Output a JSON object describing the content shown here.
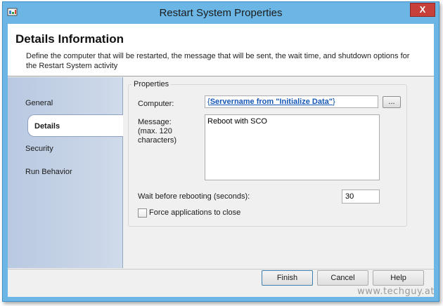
{
  "window": {
    "title": "Restart System Properties",
    "close_glyph": "X",
    "app_icon": "app-icon"
  },
  "header": {
    "title": "Details Information",
    "description": "Define the computer that will be restarted, the message that will be sent, the wait time, and shutdown options for the Restart System activity"
  },
  "sidebar": {
    "items": [
      {
        "label": "General",
        "selected": false
      },
      {
        "label": "Details",
        "selected": true
      },
      {
        "label": "Security",
        "selected": false
      },
      {
        "label": "Run Behavior",
        "selected": false
      }
    ]
  },
  "properties": {
    "group_label": "Properties",
    "computer_label": "Computer:",
    "computer_value_open": "{",
    "computer_value_link": "Servername from \"Initialize Data\"",
    "computer_value_close": "}",
    "browse_label": "...",
    "message_label": "Message:",
    "message_hint_1": "(max. 120",
    "message_hint_2": "characters)",
    "message_value": "Reboot with SCO",
    "wait_label": "Wait before rebooting (seconds):",
    "wait_value": "30",
    "force_label": "Force applications to close",
    "force_checked": false
  },
  "footer": {
    "finish_label": "Finish",
    "cancel_label": "Cancel",
    "help_label": "Help"
  },
  "watermark": "www.techguy.at",
  "colors": {
    "title_bar": "#6cb6e6",
    "close_button": "#c7403a",
    "link": "#1457b8",
    "sidebar": "#c3d1e6"
  }
}
